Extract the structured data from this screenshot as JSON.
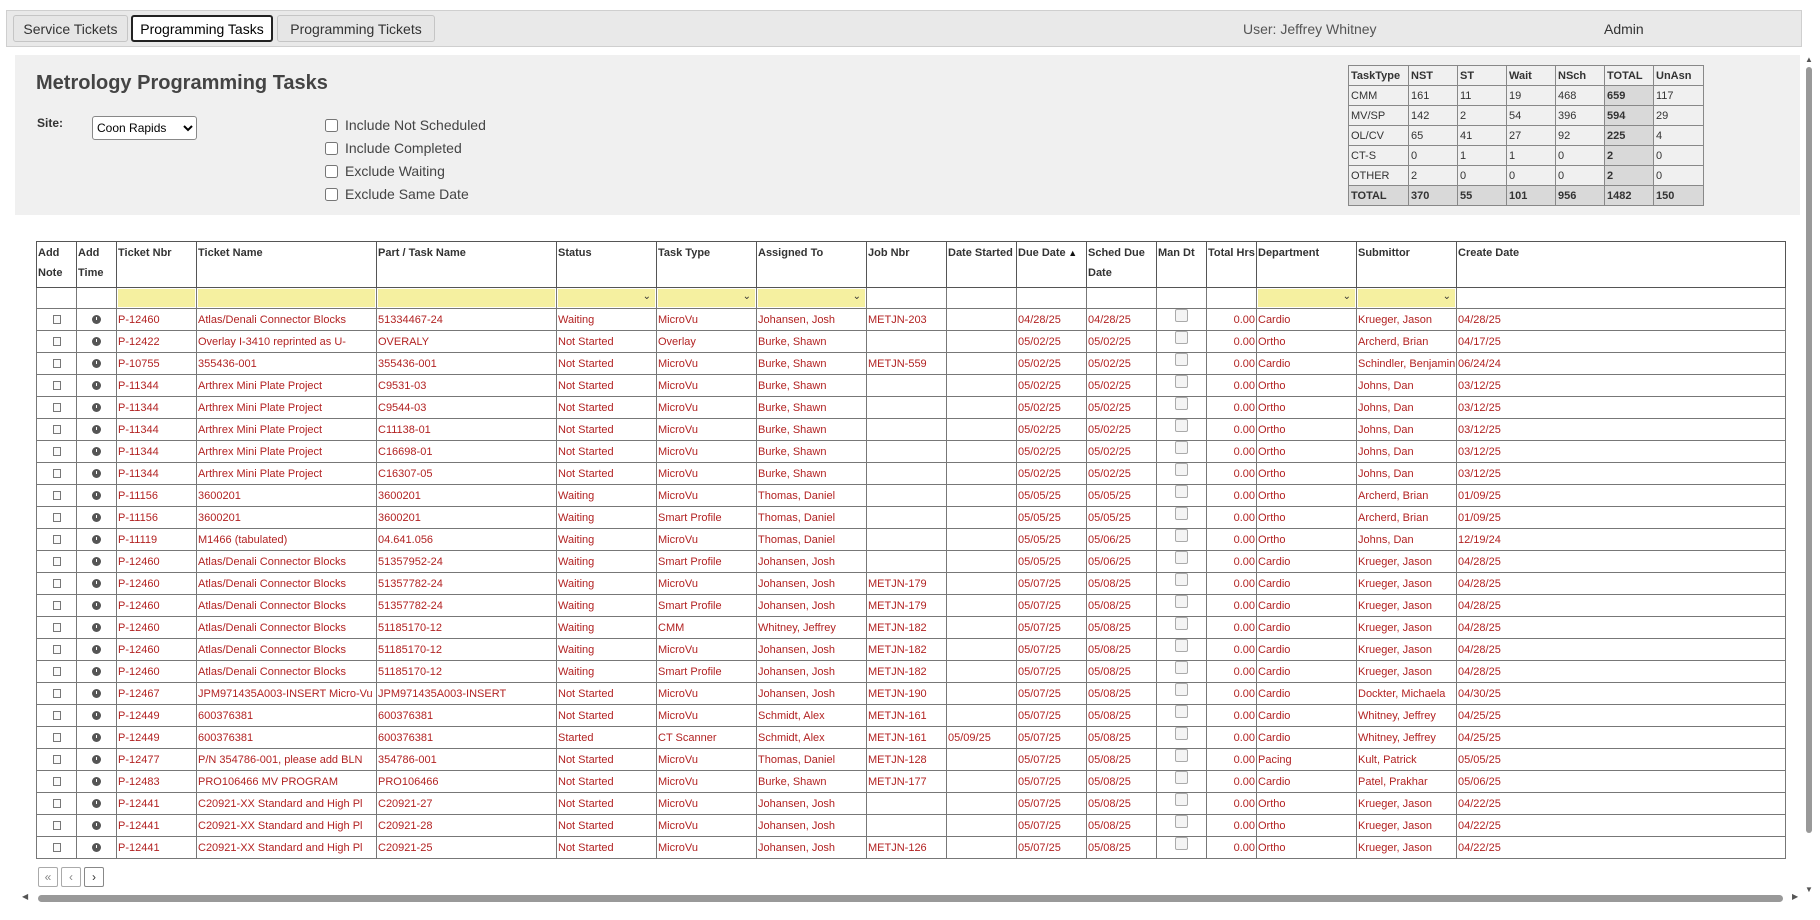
{
  "tabs": [
    {
      "label": "Service Tickets"
    },
    {
      "label": "Programming Tasks"
    },
    {
      "label": "Programming Tickets"
    }
  ],
  "header": {
    "user": "User: Jeffrey Whitney",
    "role": "Admin"
  },
  "page": {
    "title": "Metrology Programming Tasks"
  },
  "filters": {
    "site_label": "Site:",
    "site_value": "Coon Rapids",
    "checkboxes": [
      {
        "label": "Include Not Scheduled"
      },
      {
        "label": "Include Completed"
      },
      {
        "label": "Exclude Waiting"
      },
      {
        "label": "Exclude Same Date"
      }
    ]
  },
  "summary": {
    "header": [
      "TaskType",
      "NST",
      "ST",
      "Wait",
      "NSch",
      "TOTAL",
      "UnAsn"
    ],
    "rows": [
      [
        "CMM",
        "161",
        "11",
        "19",
        "468",
        "659",
        "117"
      ],
      [
        "MV/SP",
        "142",
        "2",
        "54",
        "396",
        "594",
        "29"
      ],
      [
        "OL/CV",
        "65",
        "41",
        "27",
        "92",
        "225",
        "4"
      ],
      [
        "CT-S",
        "0",
        "1",
        "1",
        "0",
        "2",
        "0"
      ],
      [
        "OTHER",
        "2",
        "0",
        "0",
        "0",
        "2",
        "0"
      ],
      [
        "TOTAL",
        "370",
        "55",
        "101",
        "956",
        "1482",
        "150"
      ]
    ]
  },
  "grid": {
    "columns": [
      {
        "label": "Add Note"
      },
      {
        "label": "Add Time"
      },
      {
        "label": "Ticket Nbr"
      },
      {
        "label": "Ticket Name"
      },
      {
        "label": "Part / Task Name"
      },
      {
        "label": "Status"
      },
      {
        "label": "Task Type"
      },
      {
        "label": "Assigned To"
      },
      {
        "label": "Job Nbr"
      },
      {
        "label": "Date Started"
      },
      {
        "label": "Due Date"
      },
      {
        "label": "Sched Due Date"
      },
      {
        "label": "Man Dt"
      },
      {
        "label": "Total Hrs"
      },
      {
        "label": "Department"
      },
      {
        "label": "Submittor"
      },
      {
        "label": "Create Date"
      }
    ],
    "rows": [
      [
        "P-12460",
        "Atlas/Denali Connector Blocks",
        "51334467-24",
        "Waiting",
        "MicroVu",
        "Johansen, Josh",
        "METJN-203",
        "",
        "04/28/25",
        "04/28/25",
        "0.00",
        "Cardio",
        "Krueger, Jason",
        "04/28/25"
      ],
      [
        "P-12422",
        "Overlay I-3410 reprinted as U-",
        "OVERALY",
        "Not Started",
        "Overlay",
        "Burke, Shawn",
        "",
        "",
        "05/02/25",
        "05/02/25",
        "0.00",
        "Ortho",
        "Archerd, Brian",
        "04/17/25"
      ],
      [
        "P-10755",
        "355436-001",
        "355436-001",
        "Not Started",
        "MicroVu",
        "Burke, Shawn",
        "METJN-559",
        "",
        "05/02/25",
        "05/02/25",
        "0.00",
        "Cardio",
        "Schindler, Benjamin",
        "06/24/24"
      ],
      [
        "P-11344",
        "Arthrex Mini Plate Project",
        "C9531-03",
        "Not Started",
        "MicroVu",
        "Burke, Shawn",
        "",
        "",
        "05/02/25",
        "05/02/25",
        "0.00",
        "Ortho",
        "Johns, Dan",
        "03/12/25"
      ],
      [
        "P-11344",
        "Arthrex Mini Plate Project",
        "C9544-03",
        "Not Started",
        "MicroVu",
        "Burke, Shawn",
        "",
        "",
        "05/02/25",
        "05/02/25",
        "0.00",
        "Ortho",
        "Johns, Dan",
        "03/12/25"
      ],
      [
        "P-11344",
        "Arthrex Mini Plate Project",
        "C11138-01",
        "Not Started",
        "MicroVu",
        "Burke, Shawn",
        "",
        "",
        "05/02/25",
        "05/02/25",
        "0.00",
        "Ortho",
        "Johns, Dan",
        "03/12/25"
      ],
      [
        "P-11344",
        "Arthrex Mini Plate Project",
        "C16698-01",
        "Not Started",
        "MicroVu",
        "Burke, Shawn",
        "",
        "",
        "05/02/25",
        "05/02/25",
        "0.00",
        "Ortho",
        "Johns, Dan",
        "03/12/25"
      ],
      [
        "P-11344",
        "Arthrex Mini Plate Project",
        "C16307-05",
        "Not Started",
        "MicroVu",
        "Burke, Shawn",
        "",
        "",
        "05/02/25",
        "05/02/25",
        "0.00",
        "Ortho",
        "Johns, Dan",
        "03/12/25"
      ],
      [
        "P-11156",
        "3600201",
        "3600201",
        "Waiting",
        "MicroVu",
        "Thomas, Daniel",
        "",
        "",
        "05/05/25",
        "05/05/25",
        "0.00",
        "Ortho",
        "Archerd, Brian",
        "01/09/25"
      ],
      [
        "P-11156",
        "3600201",
        "3600201",
        "Waiting",
        "Smart Profile",
        "Thomas, Daniel",
        "",
        "",
        "05/05/25",
        "05/05/25",
        "0.00",
        "Ortho",
        "Archerd, Brian",
        "01/09/25"
      ],
      [
        "P-11119",
        "M1466 (tabulated)",
        "04.641.056",
        "Waiting",
        "MicroVu",
        "Thomas, Daniel",
        "",
        "",
        "05/05/25",
        "05/06/25",
        "0.00",
        "Ortho",
        "Johns, Dan",
        "12/19/24"
      ],
      [
        "P-12460",
        "Atlas/Denali Connector Blocks",
        "51357952-24",
        "Waiting",
        "Smart Profile",
        "Johansen, Josh",
        "",
        "",
        "05/05/25",
        "05/06/25",
        "0.00",
        "Cardio",
        "Krueger, Jason",
        "04/28/25"
      ],
      [
        "P-12460",
        "Atlas/Denali Connector Blocks",
        "51357782-24",
        "Waiting",
        "MicroVu",
        "Johansen, Josh",
        "METJN-179",
        "",
        "05/07/25",
        "05/08/25",
        "0.00",
        "Cardio",
        "Krueger, Jason",
        "04/28/25"
      ],
      [
        "P-12460",
        "Atlas/Denali Connector Blocks",
        "51357782-24",
        "Waiting",
        "Smart Profile",
        "Johansen, Josh",
        "METJN-179",
        "",
        "05/07/25",
        "05/08/25",
        "0.00",
        "Cardio",
        "Krueger, Jason",
        "04/28/25"
      ],
      [
        "P-12460",
        "Atlas/Denali Connector Blocks",
        "51185170-12",
        "Waiting",
        "CMM",
        "Whitney, Jeffrey",
        "METJN-182",
        "",
        "05/07/25",
        "05/08/25",
        "0.00",
        "Cardio",
        "Krueger, Jason",
        "04/28/25"
      ],
      [
        "P-12460",
        "Atlas/Denali Connector Blocks",
        "51185170-12",
        "Waiting",
        "MicroVu",
        "Johansen, Josh",
        "METJN-182",
        "",
        "05/07/25",
        "05/08/25",
        "0.00",
        "Cardio",
        "Krueger, Jason",
        "04/28/25"
      ],
      [
        "P-12460",
        "Atlas/Denali Connector Blocks",
        "51185170-12",
        "Waiting",
        "Smart Profile",
        "Johansen, Josh",
        "METJN-182",
        "",
        "05/07/25",
        "05/08/25",
        "0.00",
        "Cardio",
        "Krueger, Jason",
        "04/28/25"
      ],
      [
        "P-12467",
        "JPM971435A003-INSERT Micro-Vu",
        "JPM971435A003-INSERT",
        "Not Started",
        "MicroVu",
        "Johansen, Josh",
        "METJN-190",
        "",
        "05/07/25",
        "05/08/25",
        "0.00",
        "Cardio",
        "Dockter, Michaela",
        "04/30/25"
      ],
      [
        "P-12449",
        "600376381",
        "600376381",
        "Not Started",
        "MicroVu",
        "Schmidt, Alex",
        "METJN-161",
        "",
        "05/07/25",
        "05/08/25",
        "0.00",
        "Cardio",
        "Whitney, Jeffrey",
        "04/25/25"
      ],
      [
        "P-12449",
        "600376381",
        "600376381",
        "Started",
        "CT Scanner",
        "Schmidt, Alex",
        "METJN-161",
        "05/09/25",
        "05/07/25",
        "05/08/25",
        "0.00",
        "Cardio",
        "Whitney, Jeffrey",
        "04/25/25"
      ],
      [
        "P-12477",
        "P/N 354786-001, please add BLN",
        "354786-001",
        "Not Started",
        "MicroVu",
        "Thomas, Daniel",
        "METJN-128",
        "",
        "05/07/25",
        "05/08/25",
        "0.00",
        "Pacing",
        "Kult, Patrick",
        "05/05/25"
      ],
      [
        "P-12483",
        "PRO106466 MV PROGRAM",
        "PRO106466",
        "Not Started",
        "MicroVu",
        "Burke, Shawn",
        "METJN-177",
        "",
        "05/07/25",
        "05/08/25",
        "0.00",
        "Cardio",
        "Patel, Prakhar",
        "05/06/25"
      ],
      [
        "P-12441",
        "C20921-XX Standard and High Pl",
        "C20921-27",
        "Not Started",
        "MicroVu",
        "Johansen, Josh",
        "",
        "",
        "05/07/25",
        "05/08/25",
        "0.00",
        "Ortho",
        "Krueger, Jason",
        "04/22/25"
      ],
      [
        "P-12441",
        "C20921-XX Standard and High Pl",
        "C20921-28",
        "Not Started",
        "MicroVu",
        "Johansen, Josh",
        "",
        "",
        "05/07/25",
        "05/08/25",
        "0.00",
        "Ortho",
        "Krueger, Jason",
        "04/22/25"
      ],
      [
        "P-12441",
        "C20921-XX Standard and High Pl",
        "C20921-25",
        "Not Started",
        "MicroVu",
        "Johansen, Josh",
        "METJN-126",
        "",
        "05/07/25",
        "05/08/25",
        "0.00",
        "Ortho",
        "Krueger, Jason",
        "04/22/25"
      ]
    ]
  },
  "pager": {
    "first": "«",
    "prev": "‹",
    "next": "›"
  },
  "icons": {
    "note": "note-icon",
    "time": "clock-icon",
    "sort": "sort-asc-icon",
    "dropdown": "chevron-down-icon"
  },
  "colors": {
    "row_text": "#b22222",
    "filter_bg": "#f5f0a0"
  }
}
